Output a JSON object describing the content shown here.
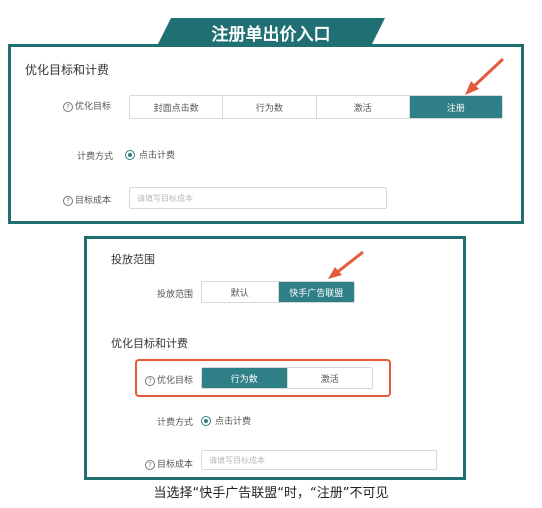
{
  "title": "注册单出价入口",
  "panel1": {
    "section_title": "优化目标和计费",
    "goal_label": "优化目标",
    "goal_options": [
      "封面点击数",
      "行为数",
      "激活",
      "注册"
    ],
    "goal_selected_index": 3,
    "billing_label": "计费方式",
    "billing_option": "点击计费",
    "cost_label": "目标成本",
    "cost_placeholder": "请填写目标成本"
  },
  "panel2": {
    "placement_section_title": "投放范围",
    "placement_label": "投放范围",
    "placement_options": [
      "默认",
      "快手广告联盟"
    ],
    "placement_selected_index": 1,
    "section_title": "优化目标和计费",
    "goal_label": "优化目标",
    "goal_options": [
      "行为数",
      "激活"
    ],
    "goal_selected_index": 0,
    "billing_label": "计费方式",
    "billing_option": "点击计费",
    "cost_label": "目标成本",
    "cost_placeholder": "请填写目标成本"
  },
  "caption": "当选择“快手广告联盟“时，“注册”不可见",
  "colors": {
    "accent": "#2f7f86",
    "frame": "#1f6f73",
    "highlight": "#e55a3c"
  }
}
